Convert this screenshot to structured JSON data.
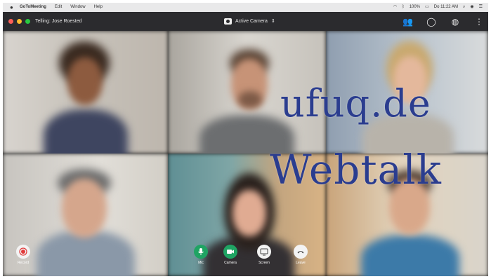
{
  "menubar": {
    "app_name": "GoToMeeting",
    "menus": [
      "Edit",
      "Window",
      "Help"
    ],
    "time": "Do 11:22 AM",
    "battery": "100%"
  },
  "titlebar": {
    "call_title": "Telling: Jose Roested",
    "camera_selector": "Active Camera",
    "camera_chevron": "⇕"
  },
  "watermark": {
    "line1": "ufuq.de",
    "line2": "Webtalk"
  },
  "controls": {
    "record": "Record",
    "mic": "Mic",
    "camera": "Camera",
    "screen": "Screen",
    "leave": "Leave"
  },
  "colors": {
    "traffic_red": "#ff5f57",
    "traffic_yellow": "#febc2e",
    "traffic_green": "#28c840",
    "active_green": "#1fa463",
    "watermark": "#2b3d8f"
  }
}
